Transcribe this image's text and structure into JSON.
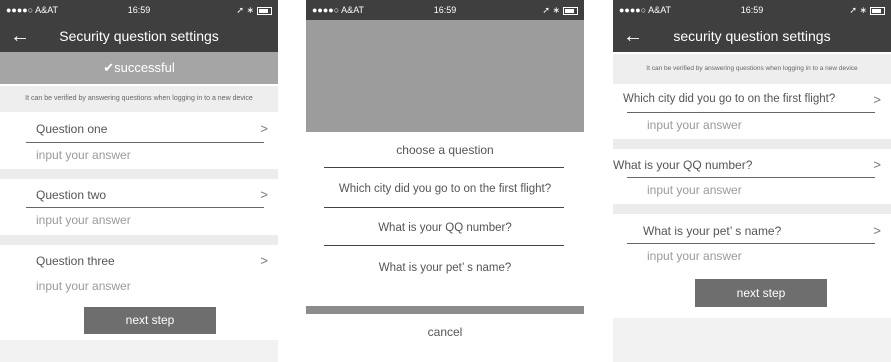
{
  "status": {
    "carrier": "●●●●○ A&AT",
    "time": "16:59"
  },
  "screen1": {
    "title": "Security question settings",
    "success": "successful",
    "hint": "It can be verified by answering questions when logging in to a new device",
    "questions": [
      {
        "label": "Question one",
        "answer_placeholder": "input your answer"
      },
      {
        "label": "Question two",
        "answer_placeholder": "input your answer"
      },
      {
        "label": "Question three",
        "answer_placeholder": "input your answer"
      }
    ],
    "next": "next step"
  },
  "screen2": {
    "sheet_title": "choose a question",
    "options": [
      "Which city did you go to on the first flight?",
      "What is your QQ number?",
      "What is your pet’ s name?"
    ],
    "cancel": "cancel"
  },
  "screen3": {
    "title": "security question settings",
    "hint": "It can be verified by answering questions when logging in to a new device",
    "questions": [
      {
        "label": "Which city did you go to on the first flight?",
        "answer_placeholder": "input your answer"
      },
      {
        "label": "What is your QQ number?",
        "answer_placeholder": "input your answer"
      },
      {
        "label": "What is your pet’ s name?",
        "answer_placeholder": "input your answer"
      }
    ],
    "next": "next step"
  }
}
